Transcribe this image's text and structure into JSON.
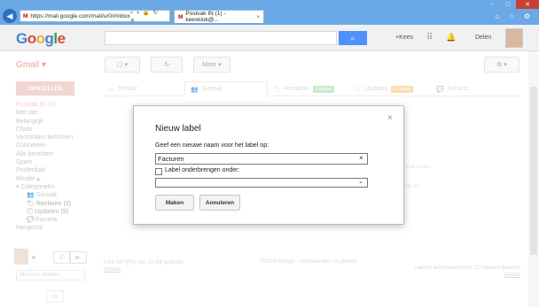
{
  "browser": {
    "back_icon": "back-arrow-icon",
    "forward_icon": "forward-arrow-icon",
    "address": "https://mail.google.com/mail/u/0/#inbox",
    "address_controls": "⌕ ▾ 🔒 ↻ ✕",
    "tab_label": "Postvak IN (1) - keeskiok@...",
    "tab_close": "×",
    "window_controls": [
      "−",
      "□",
      "✕"
    ],
    "toolbar_icons": "⌂ ☆ ⚙"
  },
  "google": {
    "logo": "Google",
    "search_button_icon": "search-icon",
    "user_link": "+Kees",
    "apps_icon": "apps-grid-icon",
    "notifications_icon": "bell-icon",
    "account_name": "Delen",
    "colors": {
      "blue": "#4a7fd8",
      "red": "#d64a3a",
      "yellow": "#e6b32e",
      "green": "#3a9b4a"
    }
  },
  "gmail": {
    "label": "Gmail ▾",
    "compose": "OPSTELLEN",
    "toolbar": {
      "select": "▢ ▾",
      "refresh": "↻",
      "more": "Meer ▾",
      "settings": "⚙ ▾"
    },
    "sidebar": {
      "items": [
        {
          "label": "Postvak IN (1)",
          "style": "active"
        },
        {
          "label": "Met ster",
          "style": ""
        },
        {
          "label": "Belangrijk",
          "style": ""
        },
        {
          "label": "Chats",
          "style": ""
        },
        {
          "label": "Verzonden berichten",
          "style": ""
        },
        {
          "label": "Concepten",
          "style": ""
        },
        {
          "label": "Alle berichten",
          "style": ""
        },
        {
          "label": "Spam",
          "style": ""
        },
        {
          "label": "Prullenbak",
          "style": ""
        },
        {
          "label": "Minder ▴",
          "style": ""
        },
        {
          "label": "▾ Categorieën",
          "style": "cat"
        },
        {
          "label": "👥 Sociaal",
          "style": "sub"
        },
        {
          "label": "🏷 Reclame (2)",
          "style": "sub bold"
        },
        {
          "label": "ⓘ Updates (5)",
          "style": "sub bold"
        },
        {
          "label": "💬 Forums",
          "style": "sub"
        },
        {
          "label": "Hangouts",
          "style": ""
        }
      ],
      "chat_search": "Mensen zoeken",
      "call_icon": "phone-icon",
      "video_icon": "video-icon",
      "chat_icon": "chat-icon"
    },
    "tabs": [
      {
        "label": "Primair",
        "icon": "inbox-icon",
        "badge": ""
      },
      {
        "label": "Sociaal",
        "icon": "people-icon",
        "badge": ""
      },
      {
        "label": "Reclame",
        "icon": "tag-icon",
        "badge": "1 nieuw"
      },
      {
        "label": "Updates",
        "icon": "info-icon",
        "badge": "1 nieuw"
      },
      {
        "label": "Forums",
        "icon": "forum-icon",
        "badge": ""
      }
    ],
    "tab_badge_colors": {
      "reclame": "#9fd9a0",
      "updates": "#f5c36e"
    },
    "ghost_text_1": "a te zetten",
    "ghost_text_2": "ak IN.",
    "footer": {
      "storage": "0,03 GB (0%) van 15 GB gebruikt",
      "manage": "Beheer",
      "copyright": "©2014 Google - Voorwaarden en privacy",
      "activity": "Laatste accountactiviteit: 11 minuten geleden",
      "details": "Details"
    }
  },
  "dialog": {
    "title": "Nieuw label",
    "close": "×",
    "prompt": "Geef een nieuwe naam voor het label op:",
    "input_value": "Facturen",
    "input_clear": "×",
    "nest_label": "Label onderbrengen onder:",
    "nest_checked": false,
    "select_value": "",
    "select_arrow": "⌄",
    "create_button": "Maken",
    "cancel_button": "Annuleren"
  }
}
